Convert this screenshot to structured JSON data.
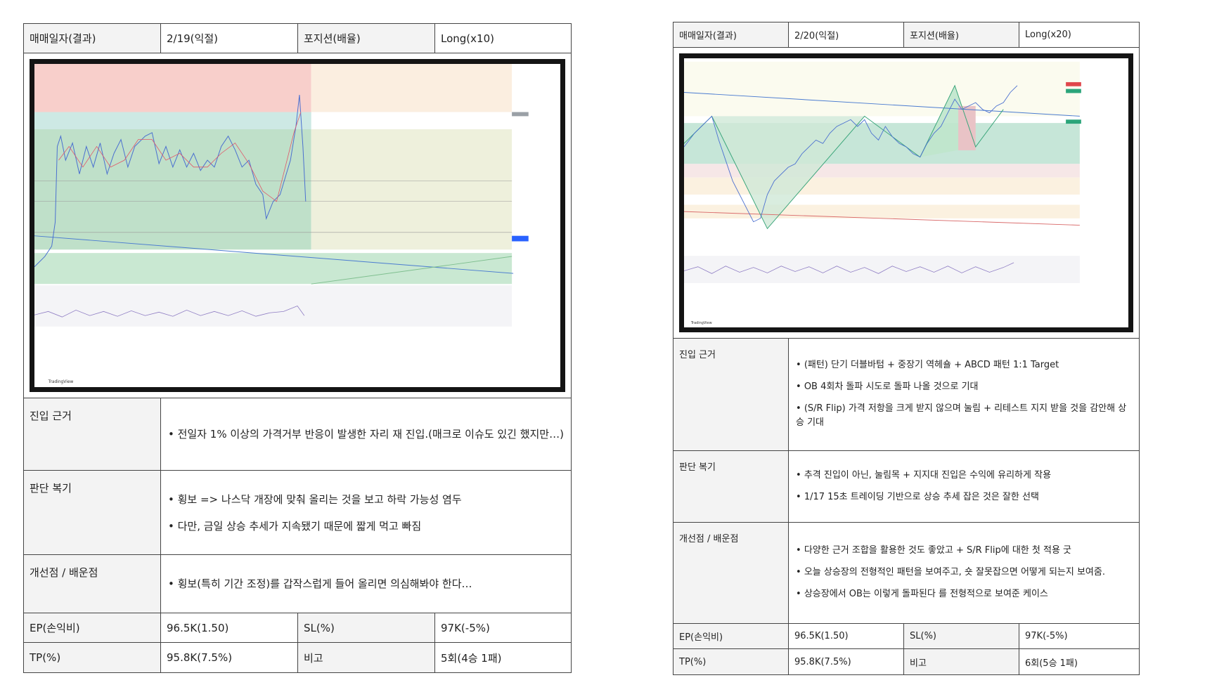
{
  "left": {
    "header": {
      "date_label": "매매일자(결과)",
      "date_value": "2/19(익절)",
      "position_label": "포지션(배율)",
      "position_value": "Long(x10)"
    },
    "basis": {
      "label": "진입 근거",
      "bullets": [
        "전일자 1% 이상의 가격거부 반응이 발생한 자리 재 진입.(매크로 이슈도 있긴 했지만…)"
      ]
    },
    "review": {
      "label": "판단 복기",
      "bullets": [
        "횡보 => 나스닥 개장에 맞춰 올리는 것을 보고 하락 가능성 염두",
        "다만, 금일 상승 추세가 지속됐기 때문에 짧게 먹고 빠짐"
      ]
    },
    "improve": {
      "label": "개선점 / 배운점",
      "bullets": [
        "횡보(특히 기간 조정)를 갑작스럽게 들어 올리면 의심해봐야 한다…"
      ]
    },
    "ep": {
      "label": "EP(손익비)",
      "value": "96.5K(1.50)"
    },
    "sl": {
      "label": "SL(%)",
      "value": "97K(-5%)"
    },
    "tp": {
      "label": "TP(%)",
      "value": "95.8K(7.5%)"
    },
    "note": {
      "label": "비고",
      "value": "5회(4승 1패)"
    }
  },
  "right": {
    "header": {
      "date_label": "매매일자(결과)",
      "date_value": "2/20(익절)",
      "position_label": "포지션(배율)",
      "position_value": "Long(x20)"
    },
    "basis": {
      "label": "진입 근거",
      "bullets": [
        "(패턴) 단기 더블바텀 + 중장기 역헤숄 + ABCD 패턴 1:1 Target",
        "OB 4회차 돌파 시도로 돌파 나올 것으로 기대",
        "(S/R Flip) 가격 저항을 크게 받지 않으며 눌림 + 리테스트 지지 받을 것을 감안해 상승 기대"
      ]
    },
    "review": {
      "label": "판단 복기",
      "bullets": [
        "추격 진입이 아닌, 눌림목 + 지지대 진입은 수익에 유리하게 작용",
        "1/17 15초 트레이딩 기반으로 상승 추세 잡은 것은 잘한 선택"
      ]
    },
    "improve": {
      "label": "개선점 / 배운점",
      "bullets": [
        "다양한 근거 조합을 활용한 것도 좋았고 + S/R Flip에 대한 첫 적용 굿",
        "오늘 상승장의 전형적인 패턴을 보여주고, 숏 잘못잡으면 어떻게 되는지 보여줌.",
        "상승장에서 OB는 이렇게 돌파된다 를 전형적으로 보여준 케이스"
      ]
    },
    "ep": {
      "label": "EP(손익비)",
      "value": "96.5K(1.50)"
    },
    "sl": {
      "label": "SL(%)",
      "value": "97K(-5%)"
    },
    "tp": {
      "label": "TP(%)",
      "value": "95.8K(7.5%)"
    },
    "note": {
      "label": "비고",
      "value": "6회(5승 1패)"
    }
  }
}
